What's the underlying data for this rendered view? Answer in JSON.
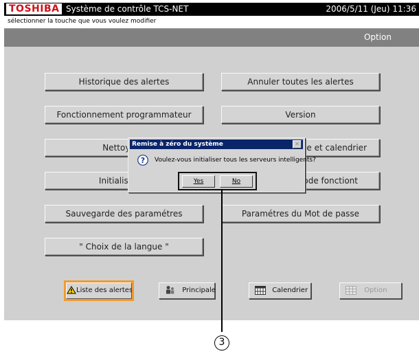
{
  "titlebar": {
    "brand": "TOSHIBA",
    "app_title": "Système de contrôle TCS-NET",
    "datetime": "2006/5/11 (Jeu) 11:36"
  },
  "hint": "sélectionner la touche que vous voulez modifier",
  "section_title": "Option",
  "menu": {
    "history": "Historique des alertes",
    "cancel_alerts": "Annuler toutes les alertes",
    "programmer": "Fonctionnement programmateur",
    "version": "Version",
    "cleaning": "Nettoyage",
    "clock_calendar": "e et calendrier",
    "initialisation": "Initialisation",
    "mode": "ode fonctiont",
    "save_params": "Sauvegarde des paramétres",
    "password_params": "Paramétres du Mot de passe",
    "language": "\" Choix de la langue \""
  },
  "bottom": {
    "alerts_list": "Liste des alertes",
    "main": "Principale",
    "calendar": "Calendrier",
    "option": "Option"
  },
  "dialog": {
    "title": "Remise à zéro du système",
    "close": "×",
    "message": "Voulez-vous initialiser tous les serveurs intelligents?",
    "yes": "Yes",
    "no": "No"
  },
  "callout": {
    "number": "3"
  },
  "colors": {
    "brand_red": "#d0101a",
    "dialog_title_bg": "#0a246a",
    "highlight_orange": "#f29a2e",
    "section_bar": "#818181"
  }
}
